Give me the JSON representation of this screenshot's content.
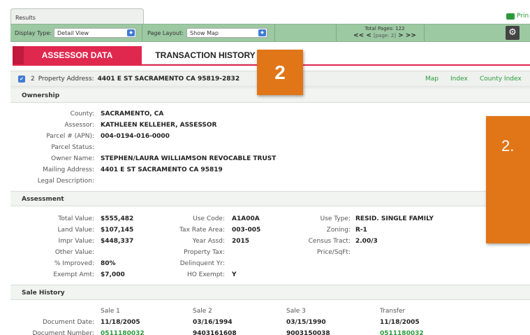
{
  "results_tab": {
    "label": "Results"
  },
  "print_label": "Prin",
  "toolbar": {
    "display_type_label": "Display Type:",
    "display_type_value": "Detail View",
    "page_layout_label": "Page Layout:",
    "page_layout_value": "Show Map",
    "total_pages": "Total Pages: 122",
    "nav_first": "<<",
    "nav_prev": "<",
    "page_indicator": "[page: 2]",
    "nav_next": ">",
    "nav_last": ">>"
  },
  "tabs": {
    "assessor": "ASSESSOR DATA",
    "transaction": "TRANSACTION HISTORY"
  },
  "property": {
    "number": "2",
    "address_label": "Property Address:",
    "address": "4401 E ST SACRAMENTO CA 95819-2832",
    "links": [
      "Map",
      "Index",
      "County Index"
    ]
  },
  "callouts": {
    "small": "2",
    "large": "2."
  },
  "ownership": {
    "title": "Ownership",
    "fields": [
      {
        "label": "County:",
        "value": "SACRAMENTO, CA"
      },
      {
        "label": "Assessor:",
        "value": "KATHLEEN KELLEHER, ASSESSOR"
      },
      {
        "label": "Parcel # (APN):",
        "value": "004-0194-016-0000"
      },
      {
        "label": "Parcel Status:",
        "value": ""
      },
      {
        "label": "Owner Name:",
        "value": "STEPHEN/LAURA WILLIAMSON REVOCABLE TRUST"
      },
      {
        "label": "Mailing Address:",
        "value": "4401 E ST SACRAMENTO CA 95819"
      },
      {
        "label": "Legal Description:",
        "value": ""
      }
    ]
  },
  "assessment": {
    "title": "Assessment",
    "col1": [
      {
        "label": "Total Value:",
        "value": "$555,482"
      },
      {
        "label": "Land Value:",
        "value": "$107,145"
      },
      {
        "label": "Impr Value:",
        "value": "$448,337"
      },
      {
        "label": "Other Value:",
        "value": ""
      },
      {
        "label": "% Improved:",
        "value": "80%"
      },
      {
        "label": "Exempt Amt:",
        "value": "$7,000"
      }
    ],
    "col2": [
      {
        "label": "Use Code:",
        "value": "A1A00A"
      },
      {
        "label": "Tax Rate Area:",
        "value": "003-005"
      },
      {
        "label": "Year Assd:",
        "value": "2015"
      },
      {
        "label": "Property Tax:",
        "value": ""
      },
      {
        "label": "Delinquent Yr:",
        "value": ""
      },
      {
        "label": "HO Exempt:",
        "value": "Y"
      }
    ],
    "col3": [
      {
        "label": "Use Type:",
        "value": "RESID. SINGLE FAMILY"
      },
      {
        "label": "Zoning:",
        "value": "R-1"
      },
      {
        "label": "Census Tract:",
        "value": "2.00/3"
      },
      {
        "label": "Price/SqFt:",
        "value": ""
      }
    ]
  },
  "sale_history": {
    "title": "Sale History",
    "headers": [
      "Sale 1",
      "Sale 2",
      "Sale 3",
      "Transfer"
    ],
    "rows": [
      {
        "label": "Document Date:",
        "values": [
          "11/18/2005",
          "03/16/1994",
          "03/15/1990",
          "11/18/2005"
        ]
      },
      {
        "label": "Document Number:",
        "values": [
          "0511180032",
          "9403161608",
          "9003150038",
          "0511180032"
        ]
      }
    ]
  },
  "colors": {
    "accent_red": "#e0284e",
    "callout_orange": "#e07618",
    "link_green": "#2b9a3b",
    "toolbar_green": "#9cc8a2"
  }
}
